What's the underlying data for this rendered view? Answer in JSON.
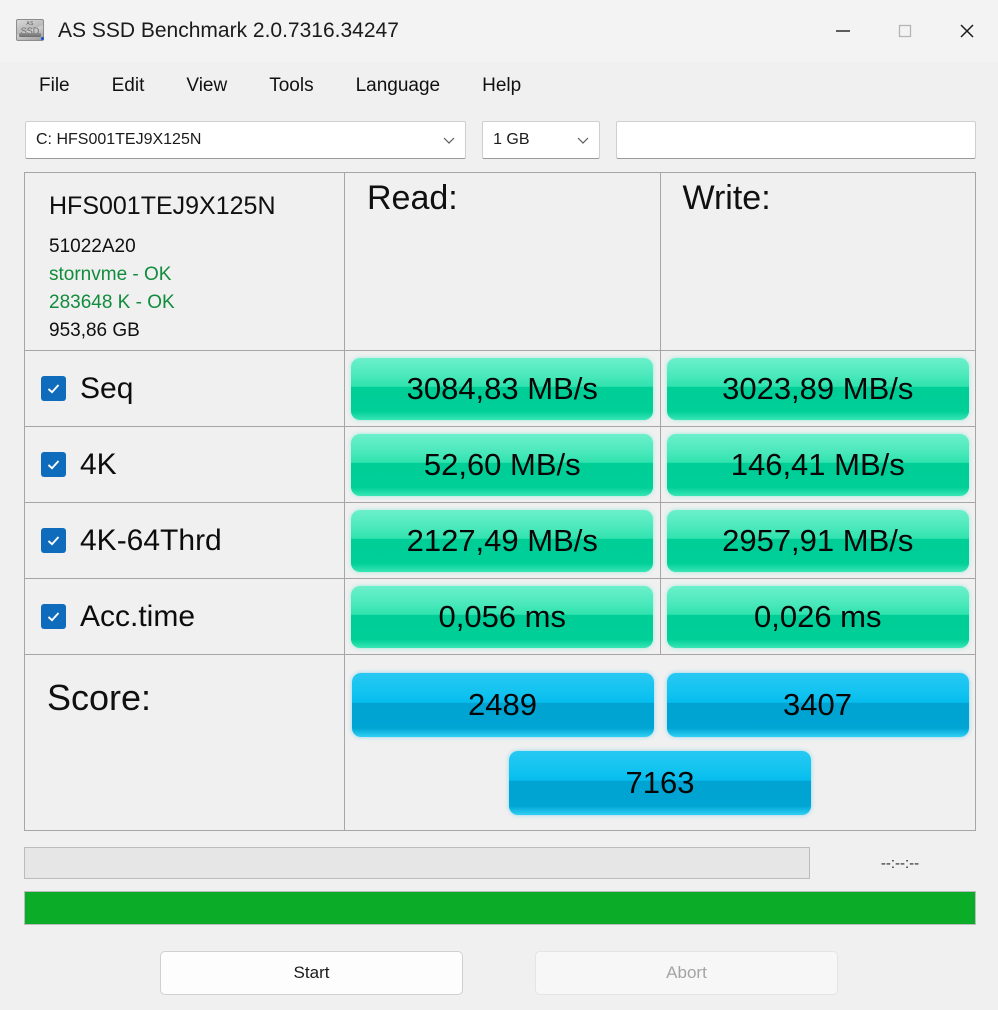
{
  "window": {
    "title": "AS SSD Benchmark 2.0.7316.34247",
    "icon": "ssd-drive-icon",
    "minimize": "—",
    "maximize": "□",
    "close": "✕"
  },
  "menu": {
    "items": [
      {
        "label": "File"
      },
      {
        "label": "Edit"
      },
      {
        "label": "View"
      },
      {
        "label": "Tools"
      },
      {
        "label": "Language"
      },
      {
        "label": "Help"
      }
    ]
  },
  "toolbar": {
    "drive": {
      "value": "C: HFS001TEJ9X125N",
      "chevron": "chevron-down-icon"
    },
    "size": {
      "value": "1 GB",
      "chevron": "chevron-down-icon"
    },
    "info_field": {
      "value": "",
      "placeholder": ""
    }
  },
  "drive_info": {
    "model": "HFS001TEJ9X125N",
    "firmware": "51022A20",
    "driver": "stornvme - OK",
    "alignment": "283648 K - OK",
    "capacity": "953,86 GB",
    "ok_color": "#118c3c"
  },
  "headers": {
    "read": "Read:",
    "write": "Write:"
  },
  "benchmarks": [
    {
      "name": "Seq",
      "checked": true,
      "read": "3084,83 MB/s",
      "write": "3023,89 MB/s"
    },
    {
      "name": "4K",
      "checked": true,
      "read": "52,60 MB/s",
      "write": "146,41 MB/s"
    },
    {
      "name": "4K-64Thrd",
      "checked": true,
      "read": "2127,49 MB/s",
      "write": "2957,91 MB/s"
    },
    {
      "name": "Acc.time",
      "checked": true,
      "read": "0,056 ms",
      "write": "0,026 ms"
    }
  ],
  "score": {
    "label": "Score:",
    "read": "2489",
    "write": "3407",
    "total": "7163"
  },
  "status": {
    "message": "",
    "timer": "--:--:--",
    "progress_percent": 100
  },
  "actions": {
    "start": "Start",
    "abort": "Abort"
  },
  "colors": {
    "result_green": "#00cf98",
    "score_blue": "#00a5d4",
    "progress_green": "#0bad28",
    "checkbox_blue": "#0f6cbd",
    "ok_green": "#118c3c"
  }
}
